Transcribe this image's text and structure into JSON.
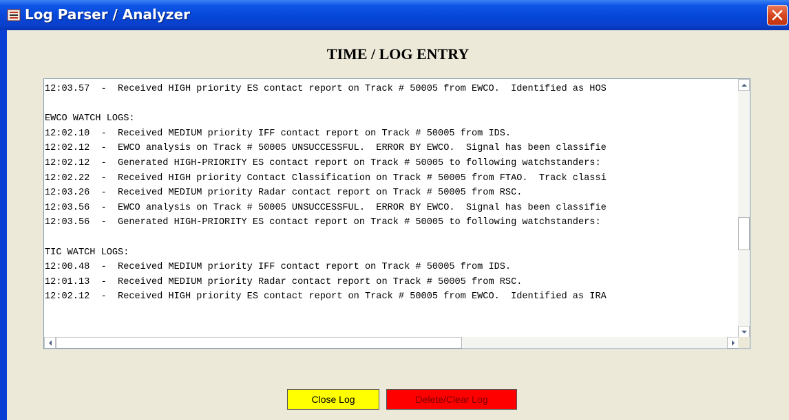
{
  "window": {
    "title": "Log Parser / Analyzer",
    "icon": "app-icon",
    "close_icon": "close-icon"
  },
  "heading": "TIME / LOG ENTRY",
  "log_lines": [
    "12:03.57  -  Received HIGH priority ES contact report on Track # 50005 from EWCO.  Identified as HOS",
    "",
    "EWCO WATCH LOGS:",
    "12:02.10  -  Received MEDIUM priority IFF contact report on Track # 50005 from IDS.",
    "12:02.12  -  EWCO analysis on Track # 50005 UNSUCCESSFUL.  ERROR BY EWCO.  Signal has been classifie",
    "12:02.12  -  Generated HIGH-PRIORITY ES contact report on Track # 50005 to following watchstanders:",
    "12:02.22  -  Received HIGH priority Contact Classification on Track # 50005 from FTAO.  Track classi",
    "12:03.26  -  Received MEDIUM priority Radar contact report on Track # 50005 from RSC.",
    "12:03.56  -  EWCO analysis on Track # 50005 UNSUCCESSFUL.  ERROR BY EWCO.  Signal has been classifie",
    "12:03.56  -  Generated HIGH-PRIORITY ES contact report on Track # 50005 to following watchstanders:",
    "",
    "TIC WATCH LOGS:",
    "12:00.48  -  Received MEDIUM priority IFF contact report on Track # 50005 from IDS.",
    "12:01.13  -  Received MEDIUM priority Radar contact report on Track # 50005 from RSC.",
    "12:02.12  -  Received HIGH priority ES contact report on Track # 50005 from EWCO.  Identified as IRA"
  ],
  "buttons": {
    "close_log": "Close Log",
    "delete_clear_log": "Delete/Clear Log"
  },
  "colors": {
    "title_bar": "#0546d8",
    "client_bg": "#ece9d8",
    "close_log_bg": "#ffff00",
    "delete_log_bg": "#ff0000"
  }
}
